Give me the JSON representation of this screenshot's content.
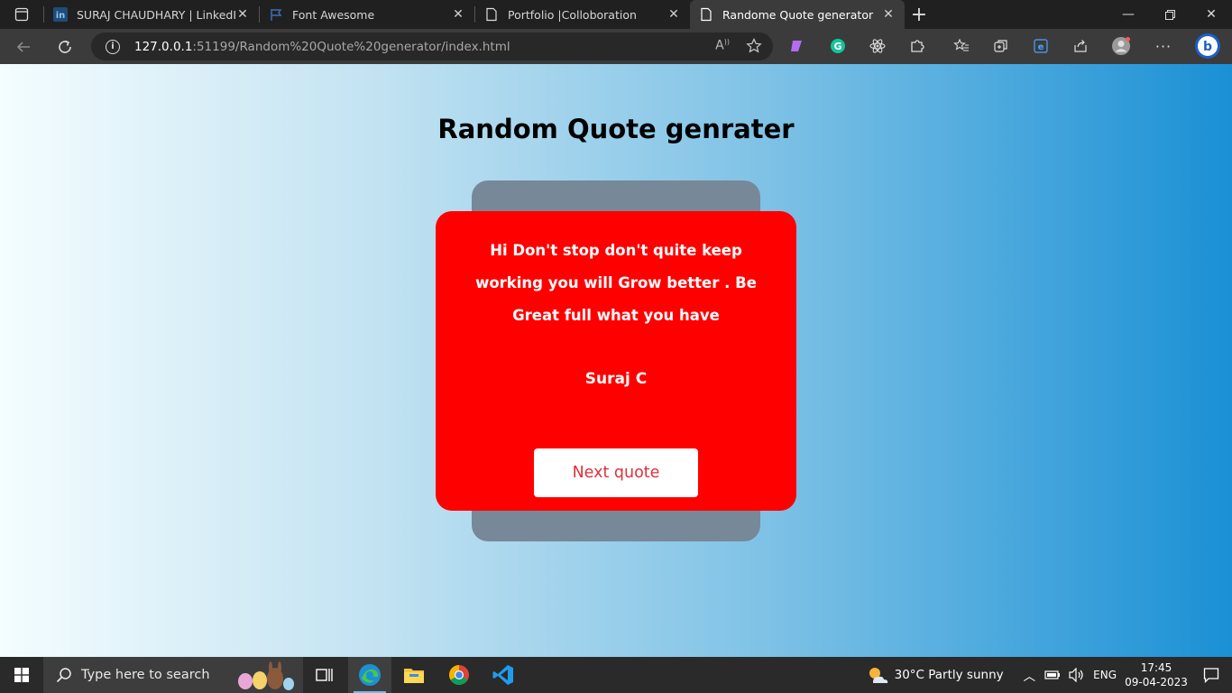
{
  "browser": {
    "tabs": [
      {
        "title": "SURAJ CHAUDHARY | LinkedIn",
        "favicon": "linkedin-icon"
      },
      {
        "title": "Font Awesome",
        "favicon": "flag-icon"
      },
      {
        "title": "Portfolio |Colloboration",
        "favicon": "page-icon"
      },
      {
        "title": "Randome Quote generator",
        "favicon": "page-icon"
      }
    ],
    "url_host": "127.0.0.1",
    "url_path": ":51199/Random%20Quote%20generator/index.html"
  },
  "page": {
    "title": "Random Quote genrater",
    "quote": "Hi Don't stop don't quite keep working you will Grow better . Be Great full what you have",
    "author": "Suraj C",
    "button_label": "Next quote"
  },
  "taskbar": {
    "search_placeholder": "Type here to search",
    "weather": "30°C  Partly sunny",
    "language": "ENG",
    "time": "17:45",
    "date": "09-04-2023"
  },
  "colors": {
    "card": "#ff0000",
    "back_card": "#778899",
    "button_text": "#e0303a",
    "gradient_start": "#f4fdff",
    "gradient_end": "#1a90d5"
  }
}
